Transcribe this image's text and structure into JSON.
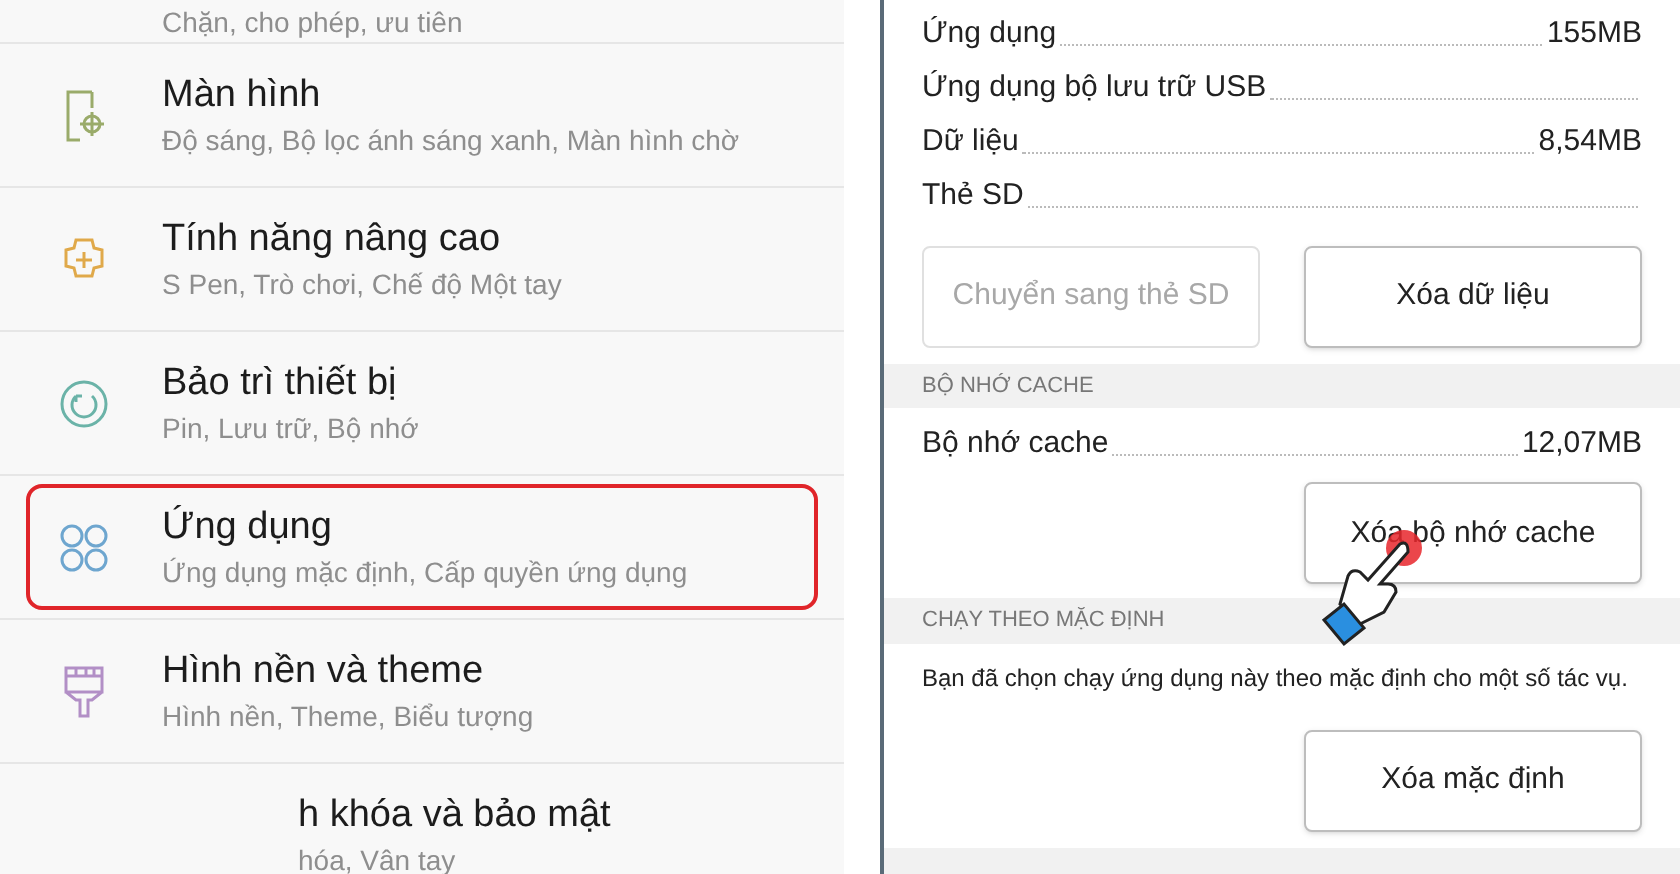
{
  "settings_list": {
    "items": [
      {
        "kind": "partial",
        "subtitle": "Chặn, cho phép, ưu tiên",
        "selected": false
      },
      {
        "kind": "display",
        "title": "Màn hình",
        "subtitle": "Độ sáng, Bộ lọc ánh sáng xanh, Màn hình chờ",
        "selected": false
      },
      {
        "kind": "advanced",
        "title": "Tính năng nâng cao",
        "subtitle": "S Pen, Trò chơi, Chế độ Một tay",
        "selected": false
      },
      {
        "kind": "maintenance",
        "title": "Bảo trì thiết bị",
        "subtitle": "Pin, Lưu trữ, Bộ nhớ",
        "selected": false
      },
      {
        "kind": "apps",
        "title": "Ứng dụng",
        "subtitle": "Ứng dụng mặc định, Cấp quyền ứng dụng",
        "selected": true
      },
      {
        "kind": "theme",
        "title": "Hình nền và theme",
        "subtitle": "Hình nền, Theme, Biểu tượng",
        "selected": false
      },
      {
        "kind": "covered",
        "title": "h khóa và bảo mật",
        "subtitle": "hóa, Vân tay",
        "selected": false
      }
    ]
  },
  "storage": {
    "rows": [
      {
        "label": "Ứng dụng",
        "value": "155MB"
      },
      {
        "label": "Ứng dụng bộ lưu trữ USB"
      },
      {
        "label": "Dữ liệu",
        "value": "8,54MB"
      },
      {
        "label": "Thẻ SD"
      }
    ],
    "buttons": [
      {
        "label": "Chuyển sang thẻ SD",
        "disabled": true
      },
      {
        "label": "Xóa dữ liệu",
        "disabled": false
      }
    ]
  },
  "cache": {
    "header": "BỘ NHỚ CACHE",
    "row": {
      "label": "Bộ nhớ cache",
      "value": "12,07MB"
    },
    "button": "Xóa bộ nhớ cache"
  },
  "defaults": {
    "header": "CHẠY THEO MẶC ĐỊNH",
    "text": "Bạn đã chọn chạy ứng dụng này theo mặc định cho một số tác vụ.",
    "button": "Xóa mặc định"
  }
}
